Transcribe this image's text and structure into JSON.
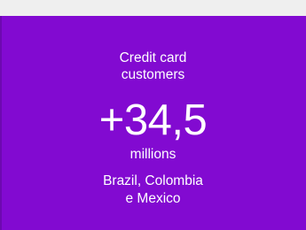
{
  "stat": {
    "label_line1": "Credit card",
    "label_line2": "customers",
    "value": "+34,5",
    "unit": "millions",
    "region_line1": "Brazil, Colombia",
    "region_line2": "e Mexico"
  },
  "colors": {
    "background": "#efefef",
    "card": "#820ad1",
    "text": "#ffffff"
  }
}
